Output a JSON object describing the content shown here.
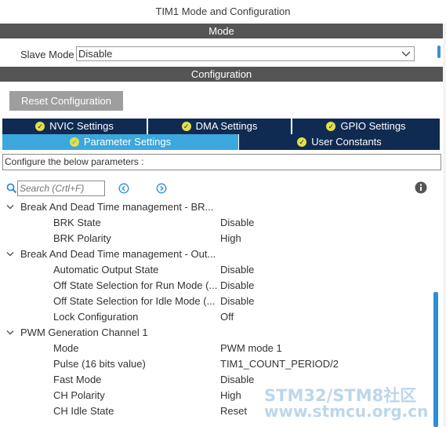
{
  "window": {
    "title": "TIM1 Mode and Configuration"
  },
  "mode_section": {
    "header": "Mode",
    "slave_mode_label": "Slave Mode",
    "slave_mode_value": "Disable"
  },
  "config_section": {
    "header": "Configuration",
    "reset_button": "Reset Configuration"
  },
  "tabs": {
    "nvic": "NVIC Settings",
    "dma": "DMA Settings",
    "gpio": "GPIO Settings",
    "parameter": "Parameter Settings",
    "user_constants": "User Constants"
  },
  "instructions": "Configure the below parameters :",
  "search": {
    "placeholder": "Search (Crtl+F)"
  },
  "groups": [
    {
      "label": "Break And Dead Time management - BR...",
      "params": [
        {
          "name": "BRK State",
          "value": "Disable"
        },
        {
          "name": "BRK Polarity",
          "value": "High"
        }
      ]
    },
    {
      "label": "Break And Dead Time management - Out...",
      "params": [
        {
          "name": "Automatic Output State",
          "value": "Disable"
        },
        {
          "name": "Off State Selection for Run Mode (...",
          "value": "Disable"
        },
        {
          "name": "Off State Selection for Idle Mode (...",
          "value": "Disable"
        },
        {
          "name": "Lock Configuration",
          "value": "Off"
        }
      ]
    },
    {
      "label": "PWM Generation Channel 1",
      "params": [
        {
          "name": "Mode",
          "value": "PWM mode 1"
        },
        {
          "name": "Pulse (16 bits value)",
          "value": "TIM1_COUNT_PERIOD/2"
        },
        {
          "name": "Fast Mode",
          "value": "Disable"
        },
        {
          "name": "CH Polarity",
          "value": "High"
        },
        {
          "name": "CH Idle State",
          "value": "Reset"
        }
      ]
    }
  ],
  "watermark": {
    "line1": "STM32/STM8社区",
    "line2": "www.stmcu.org.cn"
  },
  "colors": {
    "header_bg": "#555555",
    "tab_dark": "#0f2b52",
    "tab_active": "#3ba7dd",
    "check_icon": "#e2df4a",
    "scroll_thumb": "#2a8fd8"
  },
  "icons": {
    "tab_status": "check-circle-icon",
    "search": "search-icon",
    "prev": "arrow-left-circle-icon",
    "next": "arrow-right-circle-icon",
    "info": "info-icon",
    "expand": "chevron-down-icon",
    "dropdown": "chevron-down-icon"
  }
}
